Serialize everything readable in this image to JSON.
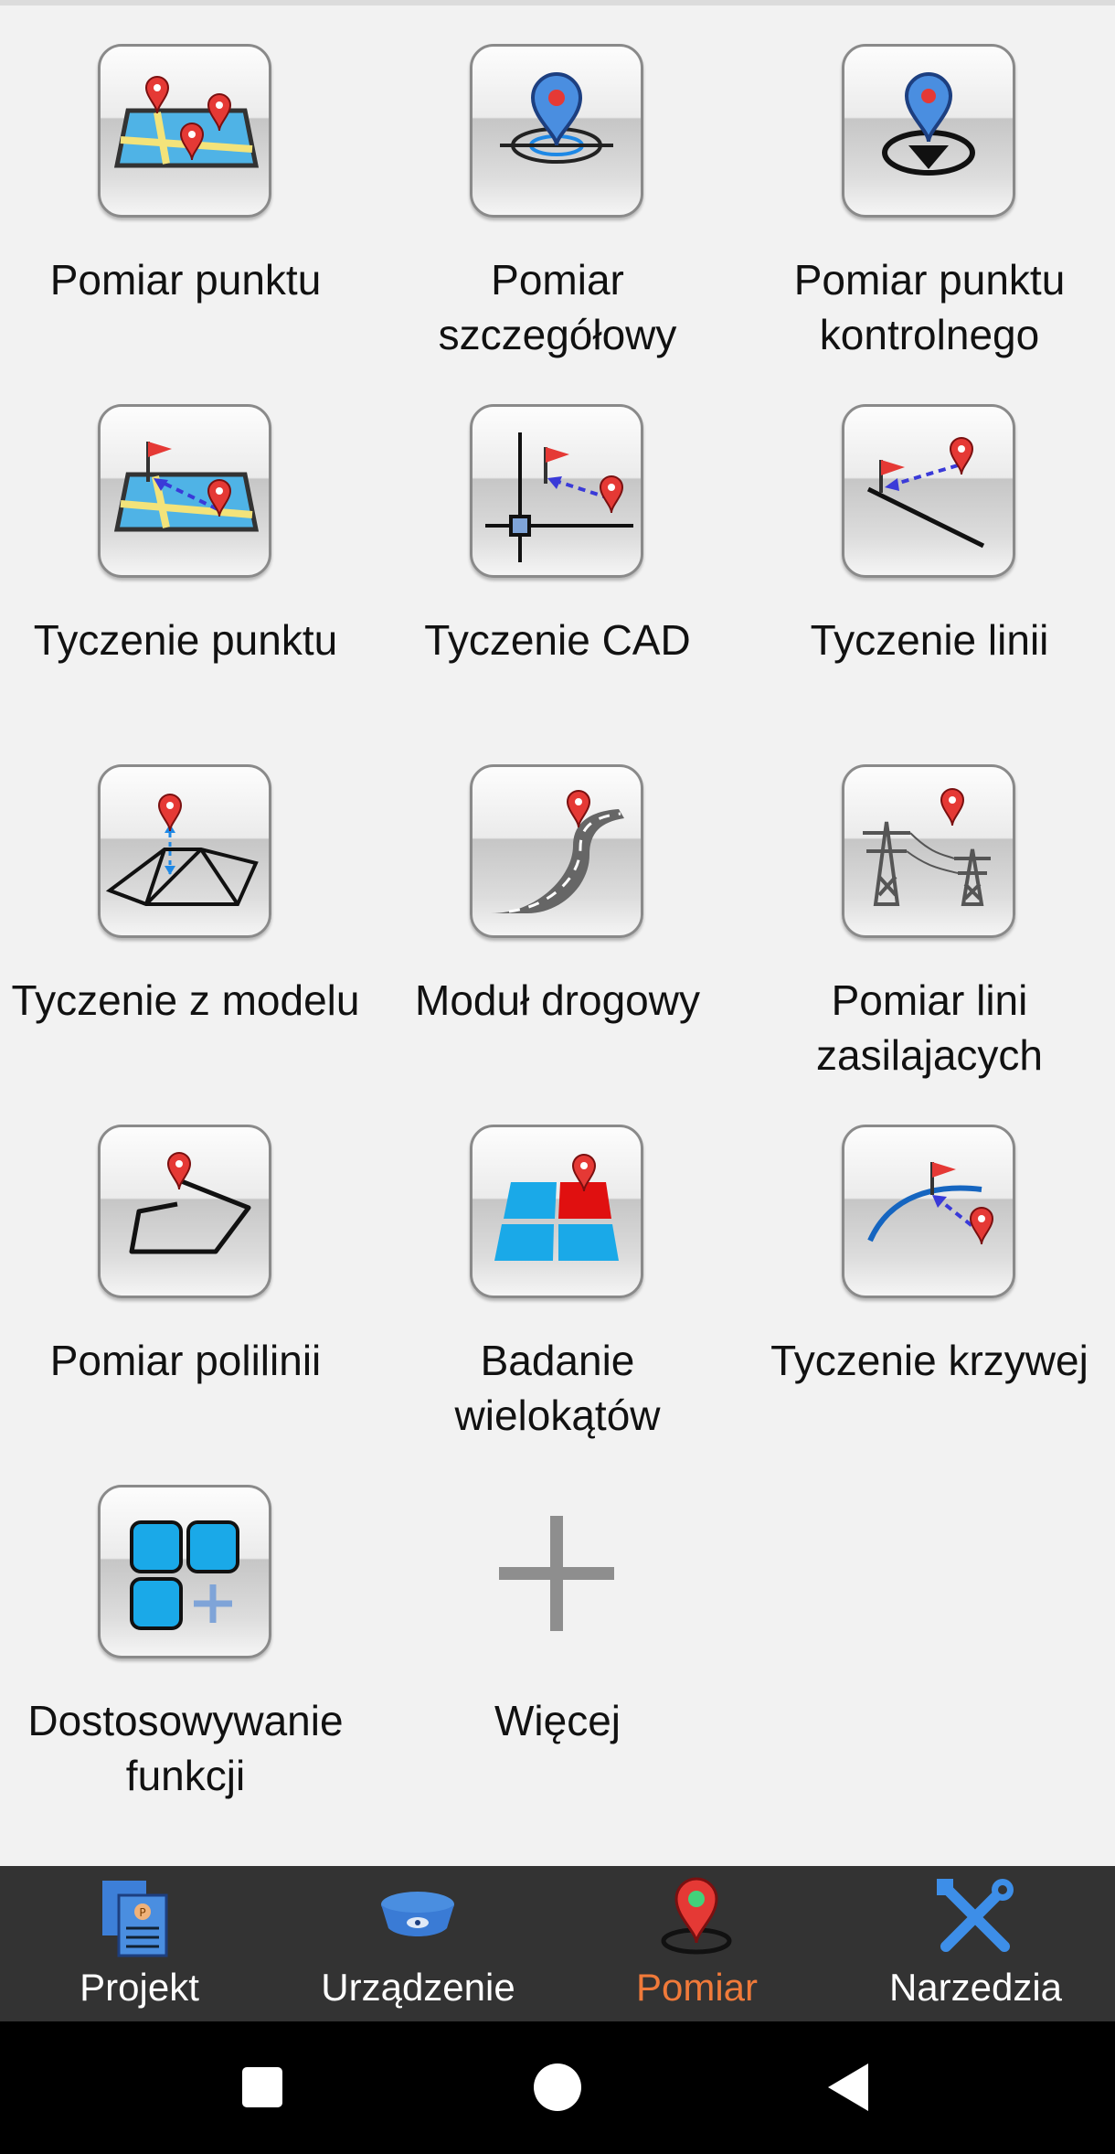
{
  "grid": {
    "items": [
      {
        "label": "Pomiar punktu",
        "icon": "map-pins-icon",
        "name": "pomiar-punktu-button"
      },
      {
        "label": "Pomiar szczegółowy",
        "icon": "detail-pin-icon",
        "name": "pomiar-szczegolowy-button"
      },
      {
        "label": "Pomiar punktu kontrolnego",
        "icon": "control-point-icon",
        "name": "pomiar-punktu-kontrolnego-button"
      },
      {
        "label": "Tyczenie punktu",
        "icon": "stakeout-map-icon",
        "name": "tyczenie-punktu-button"
      },
      {
        "label": "Tyczenie CAD",
        "icon": "cad-stakeout-icon",
        "name": "tyczenie-cad-button"
      },
      {
        "label": "Tyczenie linii",
        "icon": "line-stakeout-icon",
        "name": "tyczenie-linii-button"
      },
      {
        "label": "Tyczenie z modelu",
        "icon": "tin-model-icon",
        "name": "tyczenie-z-modelu-button"
      },
      {
        "label": "Moduł drogowy",
        "icon": "road-icon",
        "name": "modul-drogowy-button"
      },
      {
        "label": "Pomiar lini zasilajacych",
        "icon": "power-tower-icon",
        "name": "pomiar-lini-zasilajacych-button"
      },
      {
        "label": "Pomiar polilinii",
        "icon": "polyline-icon",
        "name": "pomiar-polilinii-button"
      },
      {
        "label": "Badanie wielokątów",
        "icon": "polygon-grid-icon",
        "name": "badanie-wielokatow-button"
      },
      {
        "label": "Tyczenie krzywej",
        "icon": "curve-stakeout-icon",
        "name": "tyczenie-krzywej-button"
      },
      {
        "label": "Dostosowywanie funkcji",
        "icon": "customize-squares-icon",
        "name": "dostosowywanie-funkcji-button"
      },
      {
        "label": "Więcej",
        "icon": "plus-icon",
        "name": "wiecej-button"
      }
    ]
  },
  "bottom_nav": {
    "items": [
      {
        "label": "Projekt",
        "icon": "project-documents-icon",
        "active": false
      },
      {
        "label": "Urządzenie",
        "icon": "gnss-receiver-icon",
        "active": false
      },
      {
        "label": "Pomiar",
        "icon": "survey-pin-icon",
        "active": true
      },
      {
        "label": "Narzedzia",
        "icon": "tools-icon",
        "active": false
      }
    ],
    "active_color": "#f07a3a"
  },
  "system_nav": {
    "buttons": [
      "recents-icon",
      "home-icon",
      "back-icon"
    ]
  },
  "colors": {
    "background": "#f2f2f2",
    "nav_background": "#333333",
    "pin_red": "#e53935",
    "map_blue": "#4fb3e6",
    "accent_blue": "#1e88e5"
  }
}
